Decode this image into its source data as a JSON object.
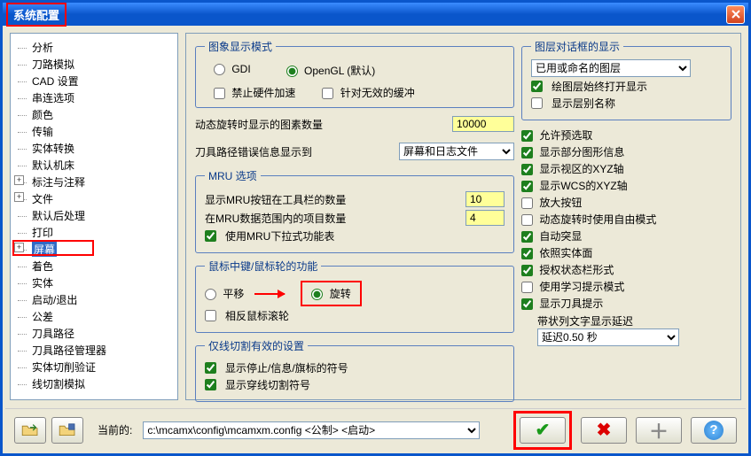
{
  "window": {
    "title": "系统配置"
  },
  "tree": {
    "items": [
      {
        "label": "分析",
        "plus": false
      },
      {
        "label": "刀路模拟",
        "plus": false
      },
      {
        "label": "CAD 设置",
        "plus": false
      },
      {
        "label": "串连选项",
        "plus": false
      },
      {
        "label": "颜色",
        "plus": false
      },
      {
        "label": "传输",
        "plus": false
      },
      {
        "label": "实体转换",
        "plus": false
      },
      {
        "label": "默认机床",
        "plus": false
      },
      {
        "label": "标注与注释",
        "plus": true
      },
      {
        "label": "文件",
        "plus": true
      },
      {
        "label": "默认后处理",
        "plus": false
      },
      {
        "label": "打印",
        "plus": false
      },
      {
        "label": "屏幕",
        "plus": true,
        "selected": true
      },
      {
        "label": "着色",
        "plus": false
      },
      {
        "label": "实体",
        "plus": false
      },
      {
        "label": "启动/退出",
        "plus": false
      },
      {
        "label": "公差",
        "plus": false
      },
      {
        "label": "刀具路径",
        "plus": false
      },
      {
        "label": "刀具路径管理器",
        "plus": false
      },
      {
        "label": "实体切削验证",
        "plus": false
      },
      {
        "label": "线切割模拟",
        "plus": false
      }
    ]
  },
  "image_mode": {
    "legend": "图象显示模式",
    "gdi": "GDI",
    "opengl": "OpenGL (默认)",
    "disable_hw": "禁止硬件加速",
    "invalid_buffer": "针对无效的缓冲"
  },
  "dyn_rotate_label": "动态旋转时显示的图素数量",
  "dyn_rotate_value": "10000",
  "tool_err_label": "刀具路径错误信息显示到",
  "tool_err_value": "屏幕和日志文件",
  "mru": {
    "legend": "MRU 选项",
    "toolbar_count_label": "显示MRU按钮在工具栏的数量",
    "toolbar_count_value": "10",
    "range_count_label": "在MRU数据范围内的项目数量",
    "range_count_value": "4",
    "dropdown": "使用MRU下拉式功能表"
  },
  "mouse": {
    "legend": "鼠标中键/鼠标轮的功能",
    "pan": "平移",
    "rotate": "旋转",
    "reverse": "相反鼠标滚轮"
  },
  "wire": {
    "legend": "仅线切割有效的设置",
    "stop_flag": "显示停止/信息/旗标的符号",
    "thread": "显示穿线切割符号"
  },
  "layer_dialog": {
    "legend": "图层对话框的显示",
    "combo": "已用或命名的图层",
    "always_open": "绘图层始终打开显示",
    "show_alias": "显示层别名称"
  },
  "right_checks": {
    "preselect": "允许预选取",
    "partial_graphic": "显示部分图形信息",
    "viewport_xyz": "显示视区的XYZ轴",
    "wcs_xyz": "显示WCS的XYZ轴",
    "zoom_btn": "放大按钮",
    "free_rotate": "动态旋转时使用自由模式",
    "auto_highlight": "自动突显",
    "by_entity": "依照实体面",
    "status_bar": "授权状态栏形式",
    "learning": "使用学习提示模式",
    "tool_tip": "显示刀具提示",
    "ribbon_delay_label": "带状列文字显示延迟",
    "ribbon_delay_value": "延迟0.50 秒"
  },
  "bottom": {
    "current_label": "当前的:",
    "path": "c:\\mcamx\\config\\mcamxm.config <公制> <启动>"
  }
}
